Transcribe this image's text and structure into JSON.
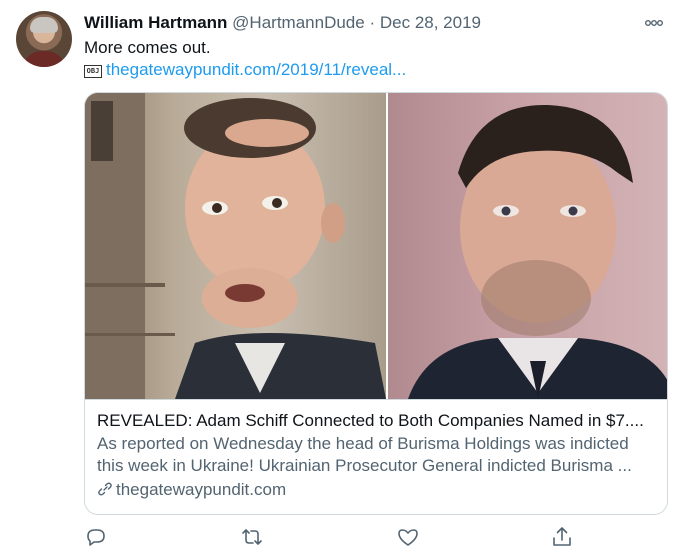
{
  "tweet": {
    "author_name": "William Hartmann",
    "author_handle": "@HartmannDude",
    "separator": "·",
    "date": "Dec 28, 2019",
    "text": "More comes out.",
    "link_text": "thegatewaypundit.com/2019/11/reveal...",
    "obj_glyph": "OBJ"
  },
  "card": {
    "title": "REVEALED: Adam Schiff Connected to Both Companies Named in $7....",
    "description": "As reported on Wednesday the head of Burisma Holdings was indicted this week in Ukraine! Ukrainian Prosecutor General indicted Burisma ...",
    "domain": "thegatewaypundit.com"
  },
  "icons": {
    "more": "more-options-icon",
    "link": "link-icon",
    "reply": "reply-icon",
    "retweet": "retweet-icon",
    "like": "like-icon",
    "share": "share-icon"
  },
  "colors": {
    "link": "#1d9bf0",
    "secondary_text": "#536471",
    "border": "#cfd9de",
    "primary_text": "#0f1419"
  }
}
